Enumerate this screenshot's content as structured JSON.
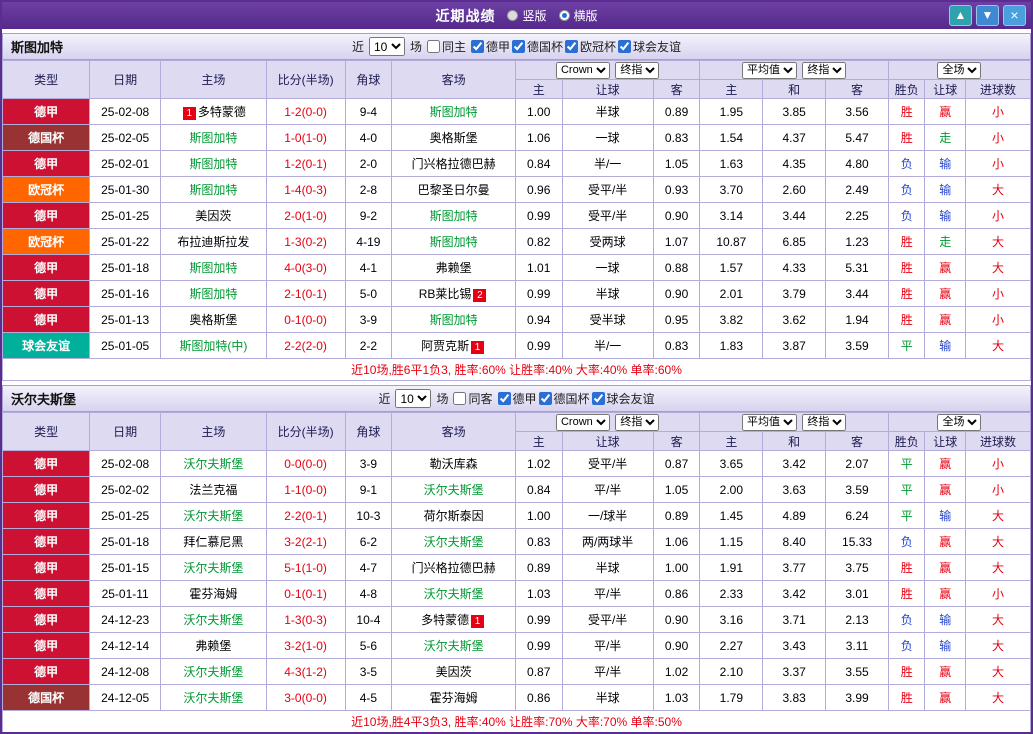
{
  "titlebar": {
    "title": "近期战绩",
    "radios": [
      {
        "label": "竖版",
        "selected": false
      },
      {
        "label": "横版",
        "selected": true
      }
    ],
    "buttons": {
      "up_glyph": "▲",
      "down_glyph": "▼",
      "close_glyph": "×"
    }
  },
  "controls": {
    "recent_label": "近",
    "count": "10",
    "games_label": "场",
    "bookmaker": "Crown",
    "final_label": "终指",
    "average": "平均值",
    "scope": "全场"
  },
  "table_header": {
    "type": "类型",
    "date": "日期",
    "home": "主场",
    "score": "比分(半场)",
    "corner": "角球",
    "away": "客场",
    "asia_home": "主",
    "asia_handicap": "让球",
    "asia_away": "客",
    "euro_home": "主",
    "euro_draw": "和",
    "euro_away": "客",
    "result": "胜负",
    "handicap_result": "让球",
    "goals": "进球数"
  },
  "colors": {
    "titlebar_bg": "#5b2d90",
    "featured_team": "#009933",
    "score": "#e60012",
    "summary": "#e60012",
    "badge_bg": "#e60012",
    "outcome": {
      "胜": "#e60012",
      "平": "#009933",
      "负": "#2244cc",
      "赢": "#e60012",
      "走": "#009933",
      "输": "#2244cc",
      "大": "#e60012",
      "小": "#e60012"
    },
    "league_colors": {
      "德甲": "#cc1133",
      "德国杯": "#993333",
      "欧冠杯": "#ff6600",
      "球会友谊": "#00b09b"
    }
  },
  "sections": [
    {
      "team": "斯图加特",
      "filter": {
        "same_venue_label": "同主",
        "competitions": [
          "德甲",
          "德国杯",
          "欧冠杯",
          "球会友谊"
        ]
      },
      "rows": [
        {
          "league": "德甲",
          "date": "25-02-08",
          "home": "多特蒙德",
          "home_badge_before": "1",
          "home_featured": false,
          "score": "1-2(0-0)",
          "corner": "9-4",
          "away": "斯图加特",
          "away_featured": true,
          "asia_home": "1.00",
          "handicap": "半球",
          "asia_away": "0.89",
          "euro_home": "1.95",
          "euro_draw": "3.85",
          "euro_away": "3.56",
          "result": "胜",
          "handicap_result": "赢",
          "goals_result": "小"
        },
        {
          "league": "德国杯",
          "date": "25-02-05",
          "home": "斯图加特",
          "home_featured": true,
          "score": "1-0(1-0)",
          "corner": "4-0",
          "away": "奥格斯堡",
          "away_featured": false,
          "asia_home": "1.06",
          "handicap": "一球",
          "asia_away": "0.83",
          "euro_home": "1.54",
          "euro_draw": "4.37",
          "euro_away": "5.47",
          "result": "胜",
          "handicap_result": "走",
          "goals_result": "小"
        },
        {
          "league": "德甲",
          "date": "25-02-01",
          "home": "斯图加特",
          "home_featured": true,
          "score": "1-2(0-1)",
          "corner": "2-0",
          "away": "门兴格拉德巴赫",
          "away_featured": false,
          "asia_home": "0.84",
          "handicap": "半/一",
          "asia_away": "1.05",
          "euro_home": "1.63",
          "euro_draw": "4.35",
          "euro_away": "4.80",
          "result": "负",
          "handicap_result": "输",
          "goals_result": "小"
        },
        {
          "league": "欧冠杯",
          "date": "25-01-30",
          "home": "斯图加特",
          "home_featured": true,
          "score": "1-4(0-3)",
          "corner": "2-8",
          "away": "巴黎圣日尔曼",
          "away_featured": false,
          "asia_home": "0.96",
          "handicap": "受平/半",
          "asia_away": "0.93",
          "euro_home": "3.70",
          "euro_draw": "2.60",
          "euro_away": "2.49",
          "result": "负",
          "handicap_result": "输",
          "goals_result": "大"
        },
        {
          "league": "德甲",
          "date": "25-01-25",
          "home": "美因茨",
          "home_featured": false,
          "score": "2-0(1-0)",
          "corner": "9-2",
          "away": "斯图加特",
          "away_featured": true,
          "asia_home": "0.99",
          "handicap": "受平/半",
          "asia_away": "0.90",
          "euro_home": "3.14",
          "euro_draw": "3.44",
          "euro_away": "2.25",
          "result": "负",
          "handicap_result": "输",
          "goals_result": "小"
        },
        {
          "league": "欧冠杯",
          "date": "25-01-22",
          "home": "布拉迪斯拉发",
          "home_featured": false,
          "score": "1-3(0-2)",
          "corner": "4-19",
          "away": "斯图加特",
          "away_featured": true,
          "asia_home": "0.82",
          "handicap": "受两球",
          "asia_away": "1.07",
          "euro_home": "10.87",
          "euro_draw": "6.85",
          "euro_away": "1.23",
          "result": "胜",
          "handicap_result": "走",
          "goals_result": "大"
        },
        {
          "league": "德甲",
          "date": "25-01-18",
          "home": "斯图加特",
          "home_featured": true,
          "score": "4-0(3-0)",
          "corner": "4-1",
          "away": "弗赖堡",
          "away_featured": false,
          "asia_home": "1.01",
          "handicap": "一球",
          "asia_away": "0.88",
          "euro_home": "1.57",
          "euro_draw": "4.33",
          "euro_away": "5.31",
          "result": "胜",
          "handicap_result": "赢",
          "goals_result": "大"
        },
        {
          "league": "德甲",
          "date": "25-01-16",
          "home": "斯图加特",
          "home_featured": true,
          "score": "2-1(0-1)",
          "corner": "5-0",
          "away": "RB莱比锡",
          "away_badge_after": "2",
          "away_featured": false,
          "asia_home": "0.99",
          "handicap": "半球",
          "asia_away": "0.90",
          "euro_home": "2.01",
          "euro_draw": "3.79",
          "euro_away": "3.44",
          "result": "胜",
          "handicap_result": "赢",
          "goals_result": "小"
        },
        {
          "league": "德甲",
          "date": "25-01-13",
          "home": "奥格斯堡",
          "home_featured": false,
          "score": "0-1(0-0)",
          "corner": "3-9",
          "away": "斯图加特",
          "away_featured": true,
          "asia_home": "0.94",
          "handicap": "受半球",
          "asia_away": "0.95",
          "euro_home": "3.82",
          "euro_draw": "3.62",
          "euro_away": "1.94",
          "result": "胜",
          "handicap_result": "赢",
          "goals_result": "小"
        },
        {
          "league": "球会友谊",
          "date": "25-01-05",
          "home": "斯图加特(中)",
          "home_featured": true,
          "score": "2-2(2-0)",
          "corner": "2-2",
          "away": "阿贾克斯",
          "away_badge_after": "1",
          "away_featured": false,
          "asia_home": "0.99",
          "handicap": "半/一",
          "asia_away": "0.83",
          "euro_home": "1.83",
          "euro_draw": "3.87",
          "euro_away": "3.59",
          "result": "平",
          "handicap_result": "输",
          "goals_result": "大"
        }
      ],
      "summary": "近10场,胜6平1负3, 胜率:60% 让胜率:40% 大率:40% 单率:60%"
    },
    {
      "team": "沃尔夫斯堡",
      "filter": {
        "same_venue_label": "同客",
        "competitions": [
          "德甲",
          "德国杯",
          "球会友谊"
        ]
      },
      "rows": [
        {
          "league": "德甲",
          "date": "25-02-08",
          "home": "沃尔夫斯堡",
          "home_featured": true,
          "score": "0-0(0-0)",
          "corner": "3-9",
          "away": "勒沃库森",
          "away_featured": false,
          "asia_home": "1.02",
          "handicap": "受平/半",
          "asia_away": "0.87",
          "euro_home": "3.65",
          "euro_draw": "3.42",
          "euro_away": "2.07",
          "result": "平",
          "handicap_result": "赢",
          "goals_result": "小"
        },
        {
          "league": "德甲",
          "date": "25-02-02",
          "home": "法兰克福",
          "home_featured": false,
          "score": "1-1(0-0)",
          "corner": "9-1",
          "away": "沃尔夫斯堡",
          "away_featured": true,
          "asia_home": "0.84",
          "handicap": "平/半",
          "asia_away": "1.05",
          "euro_home": "2.00",
          "euro_draw": "3.63",
          "euro_away": "3.59",
          "result": "平",
          "handicap_result": "赢",
          "goals_result": "小"
        },
        {
          "league": "德甲",
          "date": "25-01-25",
          "home": "沃尔夫斯堡",
          "home_featured": true,
          "score": "2-2(0-1)",
          "corner": "10-3",
          "away": "荷尔斯泰因",
          "away_featured": false,
          "asia_home": "1.00",
          "handicap": "一/球半",
          "asia_away": "0.89",
          "euro_home": "1.45",
          "euro_draw": "4.89",
          "euro_away": "6.24",
          "result": "平",
          "handicap_result": "输",
          "goals_result": "大"
        },
        {
          "league": "德甲",
          "date": "25-01-18",
          "home": "拜仁慕尼黑",
          "home_featured": false,
          "score": "3-2(2-1)",
          "corner": "6-2",
          "away": "沃尔夫斯堡",
          "away_featured": true,
          "asia_home": "0.83",
          "handicap": "两/两球半",
          "asia_away": "1.06",
          "euro_home": "1.15",
          "euro_draw": "8.40",
          "euro_away": "15.33",
          "result": "负",
          "handicap_result": "赢",
          "goals_result": "大"
        },
        {
          "league": "德甲",
          "date": "25-01-15",
          "home": "沃尔夫斯堡",
          "home_featured": true,
          "score": "5-1(1-0)",
          "corner": "4-7",
          "away": "门兴格拉德巴赫",
          "away_featured": false,
          "asia_home": "0.89",
          "handicap": "半球",
          "asia_away": "1.00",
          "euro_home": "1.91",
          "euro_draw": "3.77",
          "euro_away": "3.75",
          "result": "胜",
          "handicap_result": "赢",
          "goals_result": "大"
        },
        {
          "league": "德甲",
          "date": "25-01-11",
          "home": "霍芬海姆",
          "home_featured": false,
          "score": "0-1(0-1)",
          "corner": "4-8",
          "away": "沃尔夫斯堡",
          "away_featured": true,
          "asia_home": "1.03",
          "handicap": "平/半",
          "asia_away": "0.86",
          "euro_home": "2.33",
          "euro_draw": "3.42",
          "euro_away": "3.01",
          "result": "胜",
          "handicap_result": "赢",
          "goals_result": "小"
        },
        {
          "league": "德甲",
          "date": "24-12-23",
          "home": "沃尔夫斯堡",
          "home_featured": true,
          "score": "1-3(0-3)",
          "corner": "10-4",
          "away": "多特蒙德",
          "away_badge_after": "1",
          "away_featured": false,
          "asia_home": "0.99",
          "handicap": "受平/半",
          "asia_away": "0.90",
          "euro_home": "3.16",
          "euro_draw": "3.71",
          "euro_away": "2.13",
          "result": "负",
          "handicap_result": "输",
          "goals_result": "大"
        },
        {
          "league": "德甲",
          "date": "24-12-14",
          "home": "弗赖堡",
          "home_featured": false,
          "score": "3-2(1-0)",
          "corner": "5-6",
          "away": "沃尔夫斯堡",
          "away_featured": true,
          "asia_home": "0.99",
          "handicap": "平/半",
          "asia_away": "0.90",
          "euro_home": "2.27",
          "euro_draw": "3.43",
          "euro_away": "3.11",
          "result": "负",
          "handicap_result": "输",
          "goals_result": "大"
        },
        {
          "league": "德甲",
          "date": "24-12-08",
          "home": "沃尔夫斯堡",
          "home_featured": true,
          "score": "4-3(1-2)",
          "corner": "3-5",
          "away": "美因茨",
          "away_featured": false,
          "asia_home": "0.87",
          "handicap": "平/半",
          "asia_away": "1.02",
          "euro_home": "2.10",
          "euro_draw": "3.37",
          "euro_away": "3.55",
          "result": "胜",
          "handicap_result": "赢",
          "goals_result": "大"
        },
        {
          "league": "德国杯",
          "date": "24-12-05",
          "home": "沃尔夫斯堡",
          "home_featured": true,
          "score": "3-0(0-0)",
          "corner": "4-5",
          "away": "霍芬海姆",
          "away_featured": false,
          "asia_home": "0.86",
          "handicap": "半球",
          "asia_away": "1.03",
          "euro_home": "1.79",
          "euro_draw": "3.83",
          "euro_away": "3.99",
          "result": "胜",
          "handicap_result": "赢",
          "goals_result": "大"
        }
      ],
      "summary": "近10场,胜4平3负3, 胜率:40% 让胜率:70% 大率:70% 单率:50%"
    }
  ]
}
